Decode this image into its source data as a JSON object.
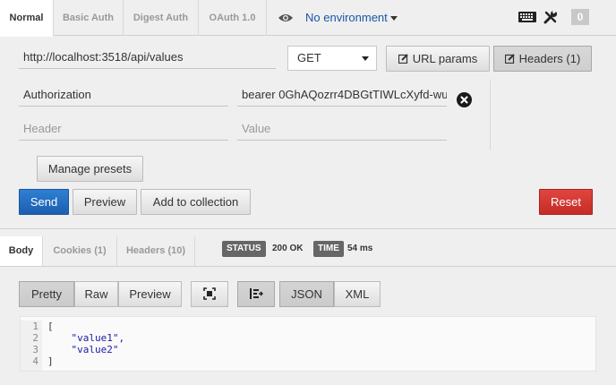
{
  "auth_tabs": [
    "Normal",
    "Basic Auth",
    "Digest Auth",
    "OAuth 1.0"
  ],
  "environment": {
    "label": "No environment",
    "icon": "eye-icon"
  },
  "toolbar": {
    "keyboard_icon": "keyboard-icon",
    "settings_icon": "wrench-icon",
    "badge_count": "0"
  },
  "request": {
    "url": "http://localhost:3518/api/values",
    "method": "GET",
    "url_params_label": "URL params",
    "headers_label": "Headers (1)"
  },
  "headers": [
    {
      "key": "Authorization",
      "value": "bearer 0GhAQozrr4DBGtTIWLcXyfd-wu"
    }
  ],
  "new_header": {
    "key_placeholder": "Header",
    "value_placeholder": "Value"
  },
  "manage_presets_label": "Manage presets",
  "actions": {
    "send": "Send",
    "preview": "Preview",
    "add_to_collection": "Add to collection",
    "reset": "Reset"
  },
  "response_tabs": [
    "Body",
    "Cookies (1)",
    "Headers (10)"
  ],
  "status": {
    "label": "STATUS",
    "value": "200 OK"
  },
  "time": {
    "label": "TIME",
    "value": "54 ms"
  },
  "view_modes": [
    "Pretty",
    "Raw",
    "Preview"
  ],
  "formats": [
    "JSON",
    "XML"
  ],
  "body": {
    "line_numbers": [
      "1",
      "2",
      "3",
      "4"
    ],
    "lines": [
      {
        "text": "[",
        "is_string": false
      },
      {
        "text": "    \"value1\",",
        "is_string": true
      },
      {
        "text": "    \"value2\"",
        "is_string": true
      },
      {
        "text": "]",
        "is_string": false
      }
    ]
  },
  "colors": {
    "send": "#1c5fb0",
    "reset": "#c52c25",
    "environment": "#1a55a8"
  }
}
